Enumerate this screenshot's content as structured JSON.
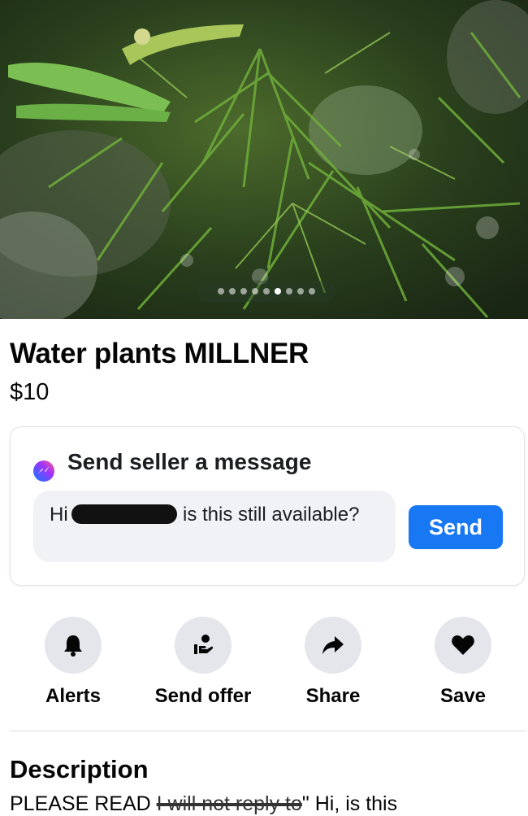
{
  "listing": {
    "title": "Water plants MILLNER",
    "price": "$10",
    "image_icon": "aquatic-plants-photo",
    "carousel_count": 9,
    "carousel_active_index": 5
  },
  "message": {
    "heading": "Send seller a message",
    "icon": "messenger-icon",
    "input_prefix": "Hi",
    "input_suffix": "is this still available?",
    "send_label": "Send",
    "send_color": "#1877f2"
  },
  "actions": [
    {
      "label": "Alerts",
      "icon": "bell-icon"
    },
    {
      "label": "Send offer",
      "icon": "offer-icon"
    },
    {
      "label": "Share",
      "icon": "share-icon"
    },
    {
      "label": "Save",
      "icon": "heart-icon"
    }
  ],
  "description": {
    "heading": "Description",
    "lead": "PLEASE READ",
    "struck": "I will not reply to",
    "rest": "\" Hi, is this"
  }
}
